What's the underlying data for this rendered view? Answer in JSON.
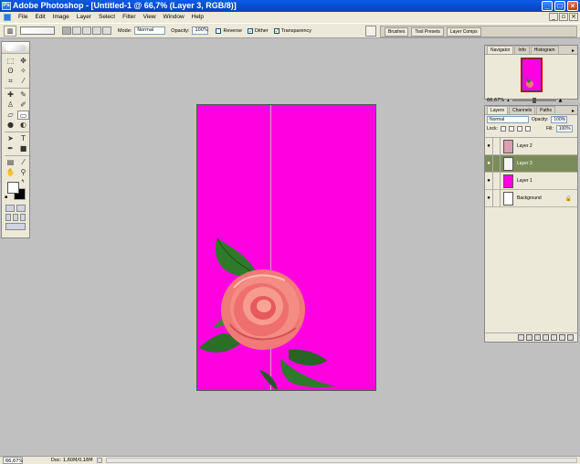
{
  "app": {
    "title": "Adobe Photoshop - [Untitled-1 @ 66,7% (Layer 3, RGB/8)]",
    "icon": "photoshop-app-icon"
  },
  "menu": [
    "File",
    "Edit",
    "Image",
    "Layer",
    "Select",
    "Filter",
    "View",
    "Window",
    "Help"
  ],
  "options": {
    "mode_label": "Mode:",
    "mode_value": "Normal",
    "opacity_label": "Opacity:",
    "opacity_value": "100%",
    "reverse_label": "Reverse",
    "reverse_checked": false,
    "dither_label": "Dither",
    "dither_checked": true,
    "transparency_label": "Transparency",
    "transparency_checked": true
  },
  "well_tabs": [
    "Brushes",
    "Tool Presets",
    "Layer Comps"
  ],
  "canvas": {
    "background": "#ff00e0"
  },
  "status": {
    "zoom": "66,67%",
    "doc": "Doc: 1,60M/0,18M"
  },
  "navigator": {
    "tabs": [
      "Navigator",
      "Info",
      "Histogram"
    ],
    "zoom": "66,67%"
  },
  "layers_panel": {
    "tabs": [
      "Layers",
      "Channels",
      "Paths"
    ],
    "blend_mode": "Normal",
    "opacity_label": "Opacity:",
    "opacity_value": "100%",
    "lock_label": "Lock:",
    "fill_label": "Fill:",
    "fill_value": "100%",
    "layers": [
      {
        "name": "Layer 2",
        "active": false,
        "thumb": "#d8a0b0"
      },
      {
        "name": "Layer 3",
        "active": true,
        "thumb": "#f4f4f4"
      },
      {
        "name": "Layer 1",
        "active": false,
        "thumb": "#ff00e0"
      },
      {
        "name": "Background",
        "active": false,
        "thumb": "#ffffff",
        "locked": true
      }
    ]
  },
  "colors": {
    "foreground": "#ffffff",
    "background": "#000000"
  }
}
